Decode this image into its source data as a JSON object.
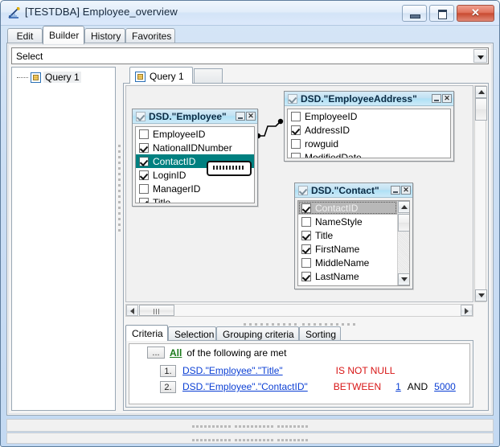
{
  "window": {
    "title": "[TESTDBA] Employee_overview",
    "icon": "query-builder-icon",
    "buttons": [
      {
        "name": "minimize-button",
        "glyph": "minimize"
      },
      {
        "name": "maximize-button",
        "glyph": "maximize"
      },
      {
        "name": "close-button",
        "glyph": "✕"
      }
    ]
  },
  "top_tabs": [
    {
      "label": "Edit",
      "active": false
    },
    {
      "label": "Builder",
      "active": true
    },
    {
      "label": "History",
      "active": false
    },
    {
      "label": "Favorites",
      "active": false
    }
  ],
  "statement_combo": {
    "value": "Select",
    "placeholder": "Select"
  },
  "tree": {
    "nodes": [
      {
        "label": "Query 1",
        "icon": "query-node-icon",
        "selected": true
      }
    ]
  },
  "query_tab": {
    "label": "Query 1",
    "icon": "query-tab-icon"
  },
  "diagram": {
    "tables": [
      {
        "name": "employee-table",
        "title": "DSD.\"Employee\"",
        "checked": true,
        "fields": [
          {
            "label": "EmployeeID",
            "checked": false,
            "state": "normal"
          },
          {
            "label": "NationalIDNumber",
            "checked": true,
            "state": "normal"
          },
          {
            "label": "ContactID",
            "checked": true,
            "state": "selected"
          },
          {
            "label": "LoginID",
            "checked": true,
            "state": "normal"
          },
          {
            "label": "ManagerID",
            "checked": false,
            "state": "normal"
          },
          {
            "label": "Title",
            "checked": true,
            "state": "normal"
          }
        ]
      },
      {
        "name": "employeeaddress-table",
        "title": "DSD.\"EmployeeAddress\"",
        "checked": true,
        "fields": [
          {
            "label": "EmployeeID",
            "checked": false,
            "state": "normal"
          },
          {
            "label": "AddressID",
            "checked": true,
            "state": "normal"
          },
          {
            "label": "rowguid",
            "checked": false,
            "state": "normal"
          },
          {
            "label": "ModifiedDate",
            "checked": false,
            "state": "normal"
          }
        ]
      },
      {
        "name": "contact-table",
        "title": "DSD.\"Contact\"",
        "checked": true,
        "fields": [
          {
            "label": "ContactID",
            "checked": true,
            "state": "selected-gray"
          },
          {
            "label": "NameStyle",
            "checked": false,
            "state": "normal"
          },
          {
            "label": "Title",
            "checked": true,
            "state": "normal"
          },
          {
            "label": "FirstName",
            "checked": true,
            "state": "normal"
          },
          {
            "label": "MiddleName",
            "checked": false,
            "state": "normal"
          },
          {
            "label": "LastName",
            "checked": true,
            "state": "normal"
          }
        ]
      }
    ],
    "table_window_buttons": {
      "minimize": "minimize-icon",
      "close": "✕"
    }
  },
  "bottom_tabs": [
    {
      "label": "Criteria",
      "active": true
    },
    {
      "label": "Selection",
      "active": false
    },
    {
      "label": "Grouping criteria",
      "active": false
    },
    {
      "label": "Sorting",
      "active": false
    }
  ],
  "criteria": {
    "ellipsis_button": "...",
    "conjunction": "All",
    "conjunction_suffix": "of the following are met",
    "rows": [
      {
        "number": "1.",
        "field": "DSD.\"Employee\".\"Title\"",
        "operator": "IS NOT NULL",
        "value_low": "",
        "and_word": "",
        "value_high": ""
      },
      {
        "number": "2.",
        "field": "DSD.\"Employee\".\"ContactID\"",
        "operator": "BETWEEN",
        "value_low": "1",
        "and_word": "AND",
        "value_high": "5000"
      }
    ]
  },
  "colors": {
    "selection_teal": "#008080",
    "link_blue": "#0b3fd4",
    "operator_red": "#d81515",
    "conjunction_green": "#1a7a1a",
    "table_header_blue": "#ade0f5"
  }
}
